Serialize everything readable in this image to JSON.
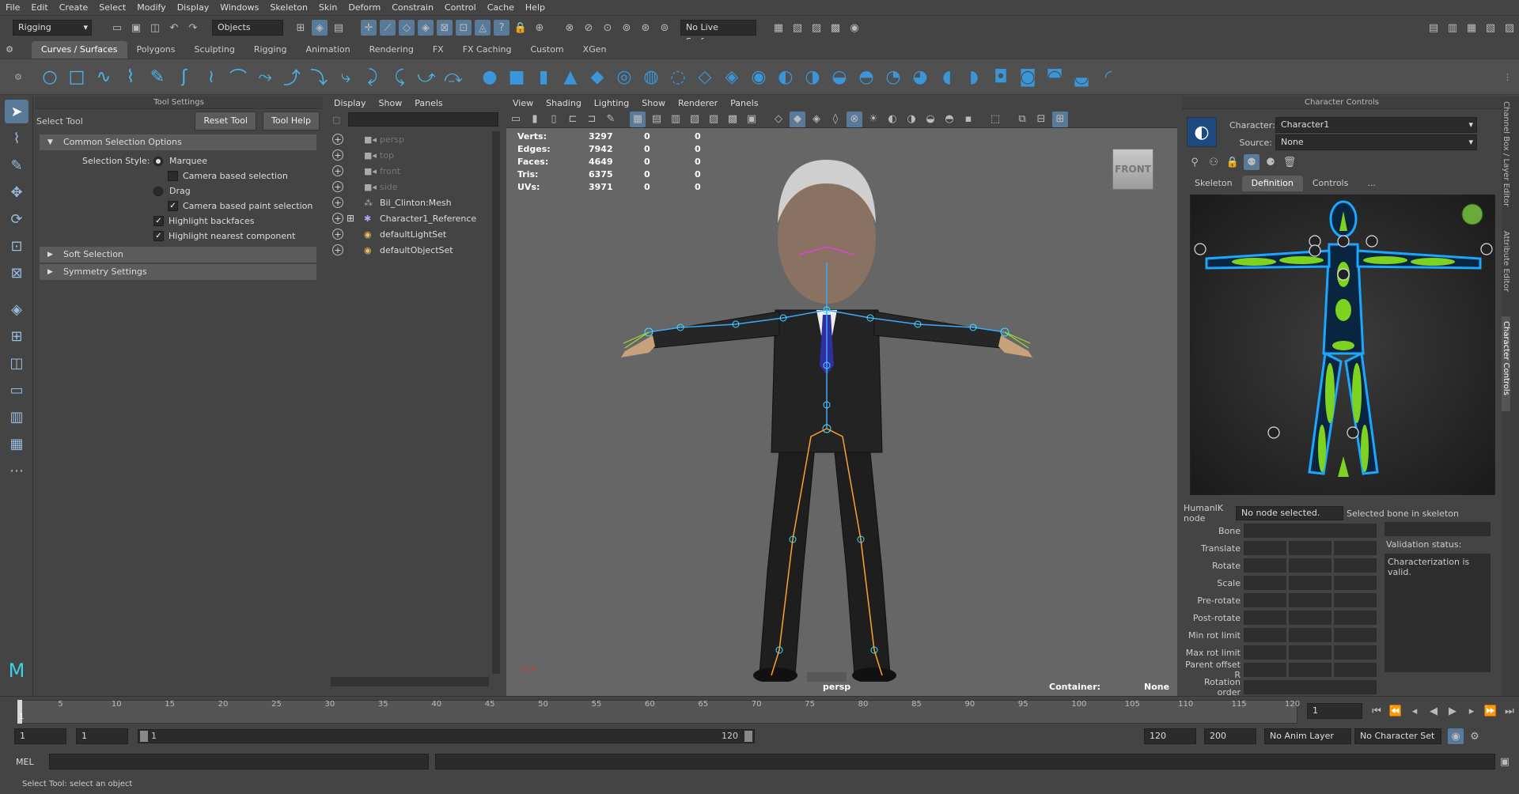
{
  "menubar": [
    "File",
    "Edit",
    "Create",
    "Select",
    "Modify",
    "Display",
    "Windows",
    "Skeleton",
    "Skin",
    "Deform",
    "Constrain",
    "Control",
    "Cache",
    "Help"
  ],
  "statusline": {
    "menuset": "Rigging",
    "selection_mode": "Objects",
    "live_surface": "No Live Surface"
  },
  "shelf_tabs": [
    "Curves / Surfaces",
    "Polygons",
    "Sculpting",
    "Rigging",
    "Animation",
    "Rendering",
    "FX",
    "FX Caching",
    "Custom",
    "XGen"
  ],
  "shelf_active_tab": "Curves / Surfaces",
  "tool_settings": {
    "panel_title": "Tool Settings",
    "tool_name": "Select Tool",
    "reset_btn": "Reset Tool",
    "help_btn": "Tool Help",
    "section_common": "Common Selection Options",
    "selection_style_label": "Selection Style:",
    "marquee": "Marquee",
    "camera_based_selection": "Camera based selection",
    "drag": "Drag",
    "camera_based_paint": "Camera based paint selection",
    "highlight_backfaces": "Highlight backfaces",
    "highlight_nearest": "Highlight nearest component",
    "section_soft": "Soft Selection",
    "section_symmetry": "Symmetry Settings"
  },
  "outliner": {
    "menus": [
      "Display",
      "Show",
      "Panels"
    ],
    "items": [
      {
        "label": "persp",
        "dim": true,
        "icon": "camera-icon"
      },
      {
        "label": "top",
        "dim": true,
        "icon": "camera-icon"
      },
      {
        "label": "front",
        "dim": true,
        "icon": "camera-icon"
      },
      {
        "label": "side",
        "dim": true,
        "icon": "camera-icon"
      },
      {
        "label": "Bil_Clinton:Mesh",
        "dim": false,
        "icon": "mesh-icon"
      },
      {
        "label": "Character1_Reference",
        "dim": false,
        "icon": "joint-icon"
      },
      {
        "label": "defaultLightSet",
        "dim": false,
        "icon": "set-icon"
      },
      {
        "label": "defaultObjectSet",
        "dim": false,
        "icon": "set-icon"
      }
    ]
  },
  "viewport": {
    "menus": [
      "View",
      "Shading",
      "Lighting",
      "Show",
      "Renderer",
      "Panels"
    ],
    "hud": [
      {
        "k": "Verts:",
        "v": "3297",
        "a": "0",
        "b": "0"
      },
      {
        "k": "Edges:",
        "v": "7942",
        "a": "0",
        "b": "0"
      },
      {
        "k": "Faces:",
        "v": "4649",
        "a": "0",
        "b": "0"
      },
      {
        "k": "Tris:",
        "v": "6375",
        "a": "0",
        "b": "0"
      },
      {
        "k": "UVs:",
        "v": "3971",
        "a": "0",
        "b": "0"
      }
    ],
    "viewcube": "FRONT",
    "camera": "persp",
    "container_label": "Container:",
    "container_value": "None"
  },
  "character_controls": {
    "panel_title": "Character Controls",
    "character_label": "Character:",
    "character_value": "Character1",
    "source_label": "Source:",
    "source_value": "None",
    "tabs": [
      "Skeleton",
      "Definition",
      "Controls",
      "..."
    ],
    "active_tab": "Definition",
    "humanik_label": "HumanIK node",
    "humanik_value": "No node selected.",
    "selected_bone_label": "Selected bone in skeleton",
    "rows": [
      "Bone",
      "Translate",
      "Rotate",
      "Scale",
      "Pre-rotate",
      "Post-rotate",
      "Min rot limit",
      "Max rot limit",
      "Parent offset R",
      "Rotation order"
    ],
    "validation_label": "Validation status:",
    "validation_value": "Characterization is valid."
  },
  "side_tabs": [
    "Channel Box / Layer Editor",
    "Attribute Editor",
    "Character Controls"
  ],
  "timeline": {
    "ticks": [
      "5",
      "10",
      "15",
      "20",
      "25",
      "30",
      "35",
      "40",
      "45",
      "50",
      "55",
      "60",
      "65",
      "70",
      "75",
      "80",
      "85",
      "90",
      "95",
      "100",
      "105",
      "110",
      "115",
      "120"
    ],
    "start_marker": "1",
    "current_frame": "1"
  },
  "range": {
    "start": "1",
    "playback_start": "1",
    "slider_start": "1",
    "slider_end": "120",
    "playback_end": "120",
    "end": "200",
    "anim_layer": "No Anim Layer",
    "char_set": "No Character Set"
  },
  "command": {
    "lang": "MEL"
  },
  "help": {
    "text": "Select Tool: select an object"
  },
  "colors": {
    "accent": "#5a7a9a",
    "shelf_icon": "#4fb4e8",
    "hik_green": "#7ed321",
    "hik_blue": "#1aa7ff"
  }
}
